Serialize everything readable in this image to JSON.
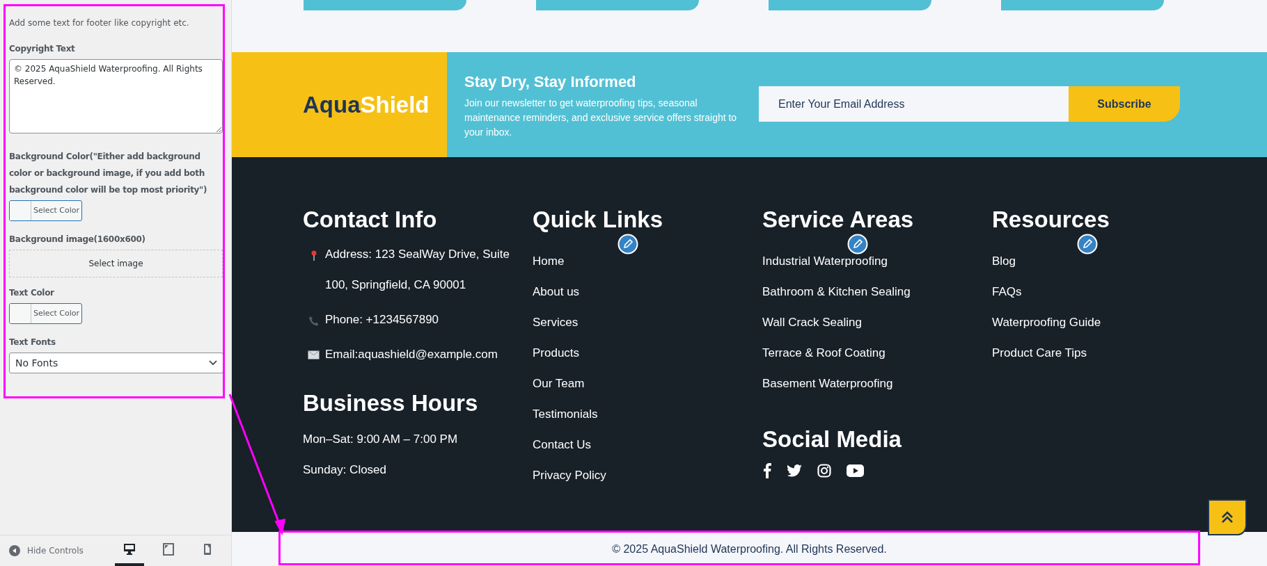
{
  "customizer": {
    "description": "Add some text for footer like copyright etc.",
    "fields": [
      {
        "kind": "textarea",
        "label": "Copyright Text",
        "value": "© 2025 AquaShield Waterproofing. All Rights Reserved."
      },
      {
        "kind": "color",
        "label": "Background Color(\"Either add background color or background image, if you add both background color will be top most priority\")",
        "button": "Select Color"
      },
      {
        "kind": "image",
        "label": "Background image(1600x600)",
        "button": "Select image"
      },
      {
        "kind": "color",
        "label": "Text Color",
        "button": "Select Color"
      },
      {
        "kind": "select",
        "label": "Text Fonts",
        "value": "No Fonts"
      }
    ],
    "bottom_bar": {
      "hide_controls": "Hide Controls",
      "devices": [
        {
          "kind": "desktop",
          "selected": true
        },
        {
          "kind": "tablet",
          "selected": false
        },
        {
          "kind": "mobile",
          "selected": false
        }
      ]
    }
  },
  "newsletter": {
    "logo": {
      "first": "Aqua",
      "second": "Shield"
    },
    "title": "Stay Dry, Stay Informed",
    "text": "Join our newsletter to get waterproofing tips, seasonal maintenance reminders, and exclusive service offers straight to your inbox.",
    "email_placeholder": "Enter Your Email Address",
    "button": "Subscribe"
  },
  "footer": {
    "columns": [
      {
        "kind": "contact",
        "title": "Contact Info",
        "edit_shortcut": false,
        "items": [
          {
            "kind": "address",
            "text": "Address: 123 SealWay Drive, Suite 100, Springfield, CA 90001"
          },
          {
            "kind": "phone",
            "text": "Phone: +1234567890"
          },
          {
            "kind": "email",
            "text": "Email:aquashield@example.com"
          }
        ],
        "hours_title": "Business Hours",
        "hours": [
          "Mon–Sat: 9:00 AM – 7:00 PM",
          "Sunday: Closed"
        ]
      },
      {
        "kind": "links",
        "title": "Quick Links",
        "edit_shortcut": true,
        "links": [
          "Home",
          "About us",
          "Services",
          "Products",
          "Our Team",
          "Testimonials",
          "Contact Us",
          "Privacy Policy"
        ]
      },
      {
        "kind": "links",
        "title": "Service Areas",
        "edit_shortcut": true,
        "links": [
          "Industrial Waterproofing",
          "Bathroom & Kitchen Sealing",
          "Wall Crack Sealing",
          "Terrace & Roof Coating",
          "Basement Waterproofing"
        ],
        "social_title": "Social Media",
        "social": [
          {
            "kind": "facebook"
          },
          {
            "kind": "twitter"
          },
          {
            "kind": "instagram"
          },
          {
            "kind": "youtube"
          }
        ]
      },
      {
        "kind": "links",
        "title": "Resources",
        "edit_shortcut": true,
        "links": [
          "Blog",
          "FAQs",
          "Waterproofing Guide",
          "Product Care Tips"
        ]
      }
    ],
    "copyright": "© 2025 AquaShield Waterproofing. All Rights Reserved."
  }
}
